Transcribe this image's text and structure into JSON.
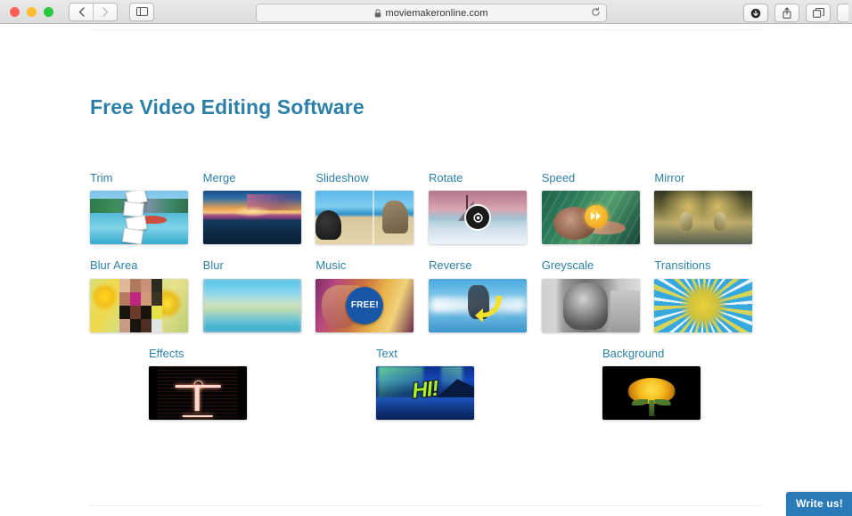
{
  "browser": {
    "url": "moviemakeronline.com",
    "lock_icon": "lock-icon",
    "reload_icon": "reload-icon",
    "back_icon": "chevron-left-icon",
    "forward_icon": "chevron-right-icon",
    "sidebar_icon": "sidebar-toggle-icon",
    "download_icon": "download-icon",
    "share_icon": "share-icon",
    "tabs_icon": "tab-overview-icon",
    "traffic_lights": [
      "close",
      "minimize",
      "maximize"
    ]
  },
  "page": {
    "title": "Free Video Editing Software",
    "accent_color": "#2c80a8",
    "write_us_label": "Write us!",
    "rows": [
      {
        "tiles": [
          {
            "label": "Trim",
            "art": "trim-thumbnail"
          },
          {
            "label": "Merge",
            "art": "merge-thumbnail"
          },
          {
            "label": "Slideshow",
            "art": "slideshow-thumbnail"
          },
          {
            "label": "Rotate",
            "art": "rotate-thumbnail"
          },
          {
            "label": "Speed",
            "art": "speed-thumbnail"
          },
          {
            "label": "Mirror",
            "art": "mirror-thumbnail"
          }
        ]
      },
      {
        "tiles": [
          {
            "label": "Blur Area",
            "art": "blur-area-thumbnail"
          },
          {
            "label": "Blur",
            "art": "blur-thumbnail"
          },
          {
            "label": "Music",
            "art": "music-thumbnail"
          },
          {
            "label": "Reverse",
            "art": "reverse-thumbnail"
          },
          {
            "label": "Greyscale",
            "art": "greyscale-thumbnail"
          },
          {
            "label": "Transitions",
            "art": "transitions-thumbnail"
          }
        ]
      },
      {
        "tiles": [
          {
            "label": "Effects",
            "art": "effects-thumbnail"
          },
          {
            "label": "Text",
            "art": "text-thumbnail"
          },
          {
            "label": "Background",
            "art": "background-thumbnail"
          }
        ]
      }
    ],
    "badges": {
      "music_badge": "FREE!",
      "text_badge": "HI!"
    }
  }
}
